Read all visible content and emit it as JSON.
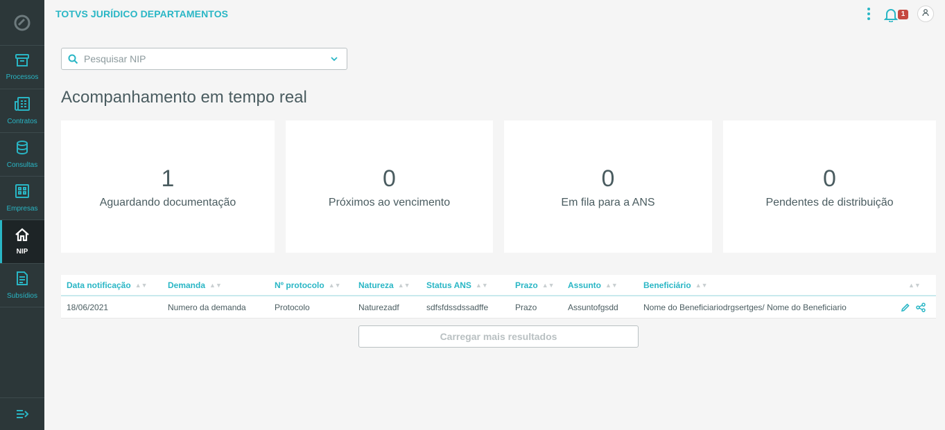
{
  "app": {
    "title": "TOTVS JURÍDICO DEPARTAMENTOS",
    "notification_count": "1",
    "logo_icon": "totvs-logo-icon"
  },
  "sidebar": {
    "items": [
      {
        "label": "Processos",
        "icon": "archive-icon"
      },
      {
        "label": "Contratos",
        "icon": "document-list-icon"
      },
      {
        "label": "Consultas",
        "icon": "database-icon"
      },
      {
        "label": "Empresas",
        "icon": "building-icon"
      },
      {
        "label": "NIP",
        "icon": "home-icon",
        "active": true
      },
      {
        "label": "Subsídios",
        "icon": "document-icon"
      }
    ],
    "collapse_icon": "menu-expand-icon"
  },
  "search": {
    "placeholder": "Pesquisar NIP",
    "value": ""
  },
  "page_title": "Acompanhamento em tempo real",
  "widgets": [
    {
      "value": "1",
      "label": "Aguardando documentação"
    },
    {
      "value": "0",
      "label": "Próximos ao vencimento"
    },
    {
      "value": "0",
      "label": "Em fila para a ANS"
    },
    {
      "value": "0",
      "label": "Pendentes de distribuição"
    }
  ],
  "table": {
    "columns": [
      "Data notificação",
      "Demanda",
      "Nº protocolo",
      "Natureza",
      "Status ANS",
      "Prazo",
      "Assunto",
      "Beneficiário"
    ],
    "rows": [
      [
        "18/06/2021",
        "Numero da demanda",
        "Protocolo",
        "Naturezadf",
        "sdfsfdssdssadffe",
        "Prazo",
        "Assuntofgsdd",
        "Nome do Beneficiariodrgsertges/ Nome do Beneficiario"
      ]
    ]
  },
  "load_more": "Carregar mais resultados",
  "colors": {
    "accent": "#29b6c5",
    "sidebar": "#2c3739",
    "badge": "#c64840",
    "text": "#4a5c60"
  }
}
